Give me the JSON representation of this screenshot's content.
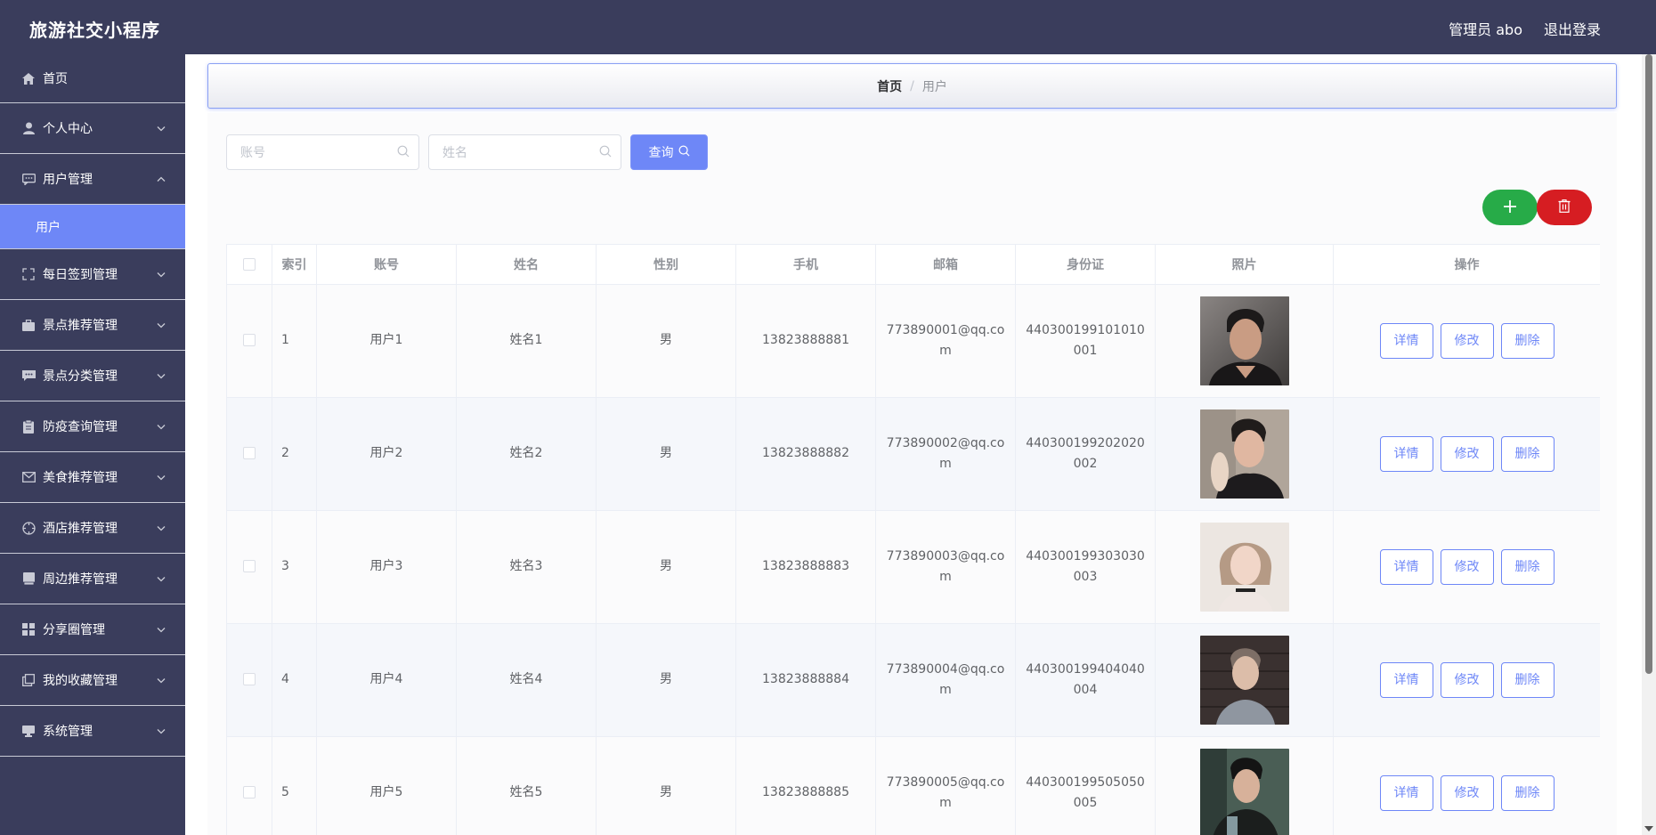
{
  "header": {
    "title": "旅游社交小程序",
    "admin": "管理员 abo",
    "logout": "退出登录"
  },
  "sidebar": {
    "items": [
      {
        "label": "首页",
        "icon": "home-icon",
        "chevron": false
      },
      {
        "label": "个人中心",
        "icon": "user-icon",
        "chevron": true
      },
      {
        "label": "用户管理",
        "icon": "chat-icon",
        "chevron": true,
        "expanded": true
      },
      {
        "label": "每日签到管理",
        "icon": "fullscreen-icon",
        "chevron": true
      },
      {
        "label": "景点推荐管理",
        "icon": "briefcase-icon",
        "chevron": true
      },
      {
        "label": "景点分类管理",
        "icon": "message-icon",
        "chevron": true
      },
      {
        "label": "防疫查询管理",
        "icon": "clipboard-icon",
        "chevron": true
      },
      {
        "label": "美食推荐管理",
        "icon": "mail-icon",
        "chevron": true
      },
      {
        "label": "酒店推荐管理",
        "icon": "compass-icon",
        "chevron": true
      },
      {
        "label": "周边推荐管理",
        "icon": "book-icon",
        "chevron": true
      },
      {
        "label": "分享圈管理",
        "icon": "grid-icon",
        "chevron": true
      },
      {
        "label": "我的收藏管理",
        "icon": "copy-icon",
        "chevron": true
      },
      {
        "label": "系统管理",
        "icon": "monitor-icon",
        "chevron": true
      }
    ],
    "submenu": {
      "label": "用户"
    }
  },
  "breadcrumb": {
    "home": "首页",
    "separator": "/",
    "current": "用户"
  },
  "search": {
    "account_placeholder": "账号",
    "name_placeholder": "姓名",
    "query_label": "查询"
  },
  "table": {
    "columns": [
      "索引",
      "账号",
      "姓名",
      "性别",
      "手机",
      "邮箱",
      "身份证",
      "照片",
      "操作"
    ],
    "actions": {
      "detail": "详情",
      "edit": "修改",
      "delete": "删除"
    },
    "rows": [
      {
        "index": "1",
        "account": "用户1",
        "name": "姓名1",
        "gender": "男",
        "phone": "13823888881",
        "email": "773890001@qq.com",
        "id_card": "440300199101010001"
      },
      {
        "index": "2",
        "account": "用户2",
        "name": "姓名2",
        "gender": "男",
        "phone": "13823888882",
        "email": "773890002@qq.com",
        "id_card": "440300199202020002"
      },
      {
        "index": "3",
        "account": "用户3",
        "name": "姓名3",
        "gender": "男",
        "phone": "13823888883",
        "email": "773890003@qq.com",
        "id_card": "440300199303030003"
      },
      {
        "index": "4",
        "account": "用户4",
        "name": "姓名4",
        "gender": "男",
        "phone": "13823888884",
        "email": "773890004@qq.com",
        "id_card": "440300199404040004"
      },
      {
        "index": "5",
        "account": "用户5",
        "name": "姓名5",
        "gender": "男",
        "phone": "13823888885",
        "email": "773890005@qq.com",
        "id_card": "440300199505050005"
      }
    ]
  },
  "colors": {
    "accent": "#6e87f7",
    "sidebar_bg": "#3a3d5c",
    "add": "#27ab48",
    "delete": "#d61d22"
  }
}
